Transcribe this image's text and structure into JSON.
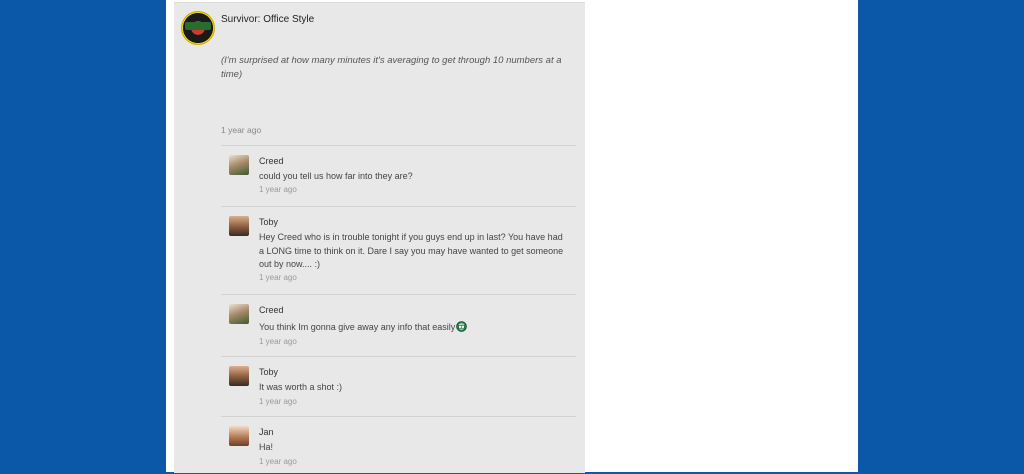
{
  "post": {
    "title": "Survivor: Office Style",
    "body": "(I'm surprised at how many minutes it's averaging to get through 10 numbers at a time)",
    "time": "1 year ago",
    "avatar_icon": "survivor-logo-icon"
  },
  "replies": [
    {
      "name": "Creed",
      "text": "could you tell us how far into they are?",
      "time": "1 year ago",
      "avatar_icon": "creed-avatar"
    },
    {
      "name": "Toby",
      "text": "Hey Creed who is in trouble tonight if you guys end up in last?  You have had a LONG time to think on it.  Dare I say you may have wanted to get someone out by now....  :)",
      "time": "1 year ago",
      "avatar_icon": "toby-avatar"
    },
    {
      "name": "Creed",
      "text": "You think Im gonna give away any info that easily",
      "time": "1 year ago",
      "avatar_icon": "creed-avatar",
      "emoji_icon": "grin-emoji-icon"
    },
    {
      "name": "Toby",
      "text": "It was worth a shot  :)",
      "time": "1 year ago",
      "avatar_icon": "toby-avatar"
    },
    {
      "name": "Jan",
      "text": "Ha!",
      "time": "1 year ago",
      "avatar_icon": "jan-avatar"
    }
  ],
  "colors": {
    "background": "#0b58a8",
    "panel": "#e8e8e8",
    "page": "#ffffff"
  }
}
